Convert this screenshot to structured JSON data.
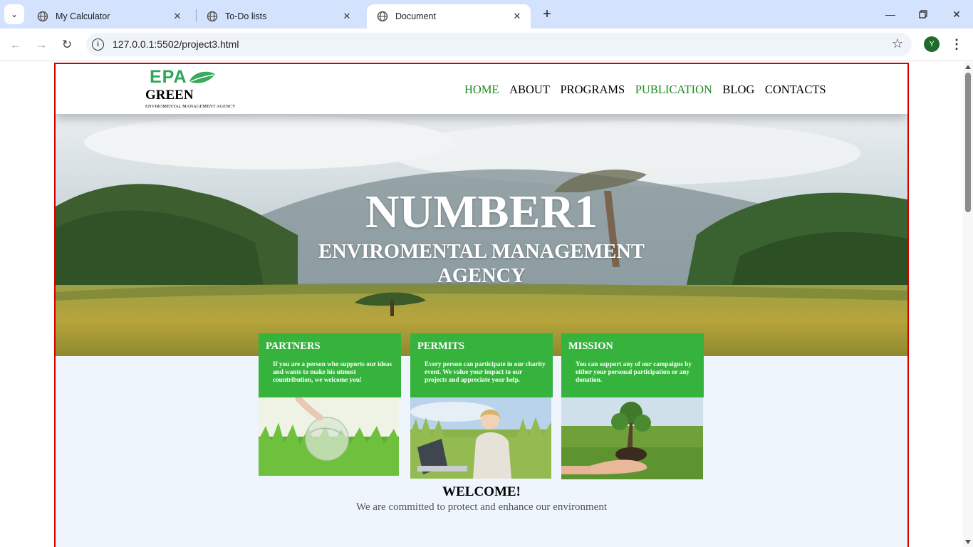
{
  "browser": {
    "tabs": [
      {
        "title": "My Calculator",
        "active": false
      },
      {
        "title": "To-Do lists",
        "active": false
      },
      {
        "title": "Document",
        "active": true
      }
    ],
    "url": "127.0.0.1:5502/project3.html",
    "profile_initial": "Y"
  },
  "site": {
    "logo": {
      "mark": "EPA",
      "name": "GREEN",
      "subtitle": "ENVIROMENTAL MANAGEMENT AGENCY"
    },
    "nav": [
      {
        "label": "HOME",
        "highlight": true
      },
      {
        "label": "ABOUT",
        "highlight": false
      },
      {
        "label": "PROGRAMS",
        "highlight": false
      },
      {
        "label": "PUBLICATION",
        "highlight": true
      },
      {
        "label": "BLOG",
        "highlight": false
      },
      {
        "label": "CONTACTS",
        "highlight": false
      }
    ],
    "hero": {
      "title": "NUMBER1",
      "subtitle": "ENVIROMENTAL MANAGEMENT AGENCY"
    },
    "cards": [
      {
        "title": "PARTNERS",
        "text": "If you are a person who supports our ideas and wants to make his utmost countribution, we welcome you!"
      },
      {
        "title": "PERMITS",
        "text": "Every person can participate in our charity event. We value your impact to our projects and appreciate your help."
      },
      {
        "title": "MISSION",
        "text": "You can support any of our campaigns by either your personal participation or any donation."
      }
    ],
    "welcome": {
      "heading": "WELCOME!",
      "tagline": "We are committed to protect and enhance our environment"
    }
  },
  "colors": {
    "accent_green": "#36b33c",
    "nav_green": "#1e8a1e",
    "frame_red": "#d40000",
    "tabbar": "#d3e3fd"
  }
}
